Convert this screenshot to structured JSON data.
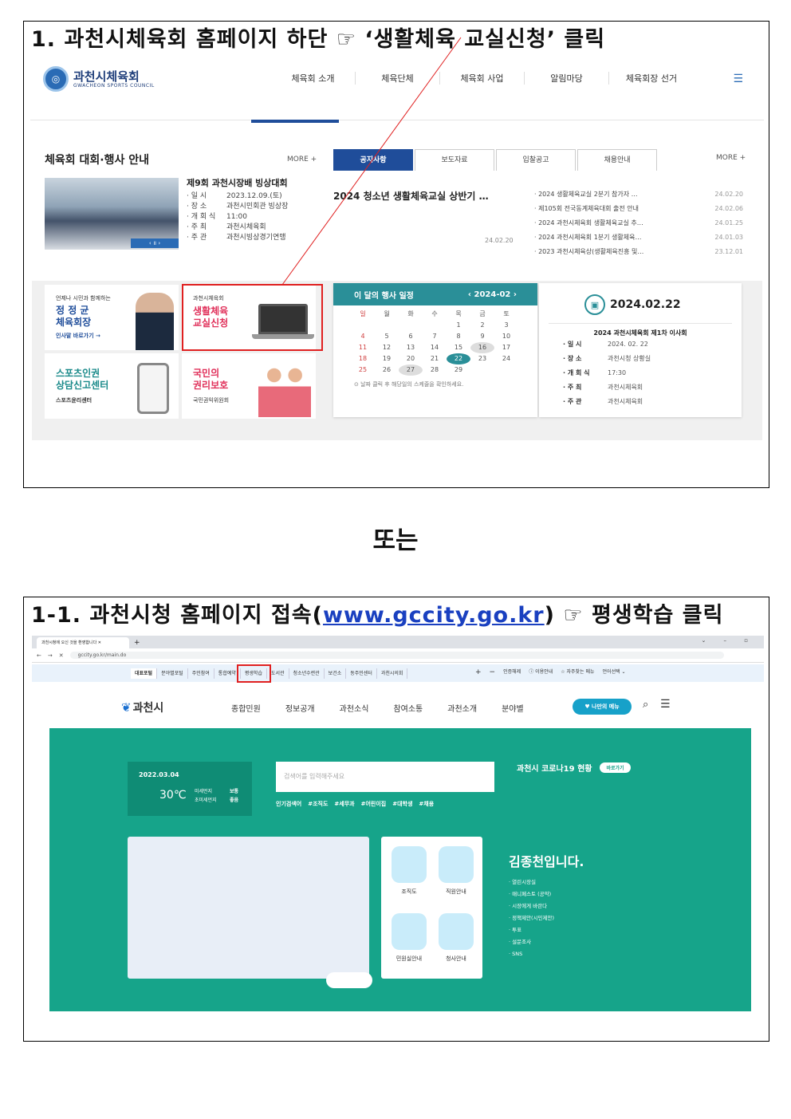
{
  "step1": {
    "title": "1. 과천시체육회 홈페이지 하단 ☞ ‘생활체육 교실신청’ 클릭",
    "site": {
      "logo_name": "과천시체육회",
      "logo_sub": "GWACHEON SPORTS COUNCIL",
      "nav": [
        "체육회 소개",
        "체육단체",
        "체육회 사업",
        "알림마당",
        "체육회장 선거"
      ],
      "events_title": "체육회 대회·행사 안내",
      "more": "MORE +",
      "event": {
        "title": "제9회 과천시장배 빙상대회",
        "rows": [
          {
            "k": "· 일    시",
            "v": "2023.12.09.(토)"
          },
          {
            "k": "· 장    소",
            "v": "과천시민회관 빙상장"
          },
          {
            "k": "· 개 회 식",
            "v": "11:00"
          },
          {
            "k": "· 주    최",
            "v": "과천시체육회"
          },
          {
            "k": "· 주    관",
            "v": "과천시빙상경기연맹"
          }
        ]
      },
      "tabs": [
        "공지사항",
        "보도자료",
        "입찰공고",
        "채용안내"
      ],
      "notice_main": "2024 청소년 생활체육교실 상반기 …",
      "notice_main_date": "24.02.20",
      "notices": [
        {
          "t": "· 2024 생활체육교실 2분기 참가자 …",
          "d": "24.02.20"
        },
        {
          "t": "· 제105회 전국동계체육대회 출전 안내",
          "d": "24.02.06"
        },
        {
          "t": "· 2024 과천시체육회 생활체육교실 추…",
          "d": "24.01.25"
        },
        {
          "t": "· 2024 과천시체육회 1분기 생활체육…",
          "d": "24.01.03"
        },
        {
          "t": "· 2023 과천시체육상(생활체육진흥 및…",
          "d": "23.12.01"
        }
      ],
      "tile_president": {
        "small": "언제나 시민과 함께하는",
        "big1": "정 정 균",
        "big2": "체육회장",
        "link": "인사말 바로가기 →"
      },
      "tile_class": {
        "small": "과천시체육회",
        "big1": "생활체육",
        "big2": "교실신청"
      },
      "tile_report": {
        "big1": "스포츠인권",
        "big2": "상담신고센터",
        "small": "스포츠윤리센터"
      },
      "tile_rights": {
        "big1": "국민의",
        "big2": "권리보호",
        "small": "국민권익위원회"
      },
      "calendar": {
        "title": "이 달의 행사 일정",
        "month": "2024-02",
        "weekdays": [
          "일",
          "월",
          "화",
          "수",
          "목",
          "금",
          "토"
        ],
        "days": [
          "",
          "",
          "",
          "",
          "1",
          "2",
          "3",
          "4",
          "5",
          "6",
          "7",
          "8",
          "9",
          "10",
          "11",
          "12",
          "13",
          "14",
          "15",
          "16",
          "17",
          "18",
          "19",
          "20",
          "21",
          "22",
          "23",
          "24",
          "25",
          "26",
          "27",
          "28",
          "29",
          "",
          ""
        ],
        "note": "날짜 클릭 후 해당일의 스케줄을 확인하세요."
      },
      "schedule": {
        "date": "2024.02.22",
        "title": "2024 과천시체육회 제1차 이사회",
        "rows": [
          {
            "k": "· 일    시",
            "v": "2024. 02. 22"
          },
          {
            "k": "· 장    소",
            "v": "과천시청 상황실"
          },
          {
            "k": "· 개 회 식",
            "v": "17:30"
          },
          {
            "k": "· 주    최",
            "v": "과천시체육회"
          },
          {
            "k": "· 주    관",
            "v": "과천시체육회"
          }
        ]
      }
    }
  },
  "or_text": "또는",
  "step2": {
    "title_pre": "1-1. 과천시청 홈페이지 접속(",
    "title_url": "www.gccity.go.kr",
    "title_post": ") ☞ 평생학습 클릭",
    "browser": {
      "tab_title": "과천시청에 오신 것을 환영합니다",
      "url": "gccity.go.kr/main.do"
    },
    "quick_links": [
      "대표포털",
      "분야별포털",
      "주민참여",
      "통합예약",
      "평생학습",
      "도서관",
      "청소년수련관",
      "보건소",
      "동주민센터",
      "과천시의회"
    ],
    "quick_right": [
      "인증해제",
      "이용안내",
      "자주찾는 메뉴",
      "언어선택"
    ],
    "logo": "과천시",
    "nav": [
      "종합민원",
      "정보공개",
      "과천소식",
      "참여소통",
      "과천소개",
      "분야별"
    ],
    "my_menu": "♥ 나만의 메뉴",
    "weather": {
      "date": "2022.03.04",
      "temp": "30℃",
      "l1": "미세먼지",
      "l2": "초미세먼지",
      "v1": "보통",
      "v2": "좋음"
    },
    "search_placeholder": "검색어를 입력해주세요",
    "tags": [
      "인기검색어",
      "#조직도",
      "#세무과",
      "#어린이집",
      "#대학생",
      "#채용"
    ],
    "covid": {
      "title": "과천시 코로나19 현황",
      "btn": "바로가기"
    },
    "quick_menu": [
      "조직도",
      "직원안내",
      "민원실안내",
      "청사안내"
    ],
    "mayor": {
      "title": "김종천입니다.",
      "items": [
        "· 열린시장실",
        "· 매니페스토 (공약)",
        "· 시장에게 바란다",
        "· 정책제안(시민제안)",
        "· 투표",
        "· 설문조사",
        "· SNS"
      ]
    }
  }
}
